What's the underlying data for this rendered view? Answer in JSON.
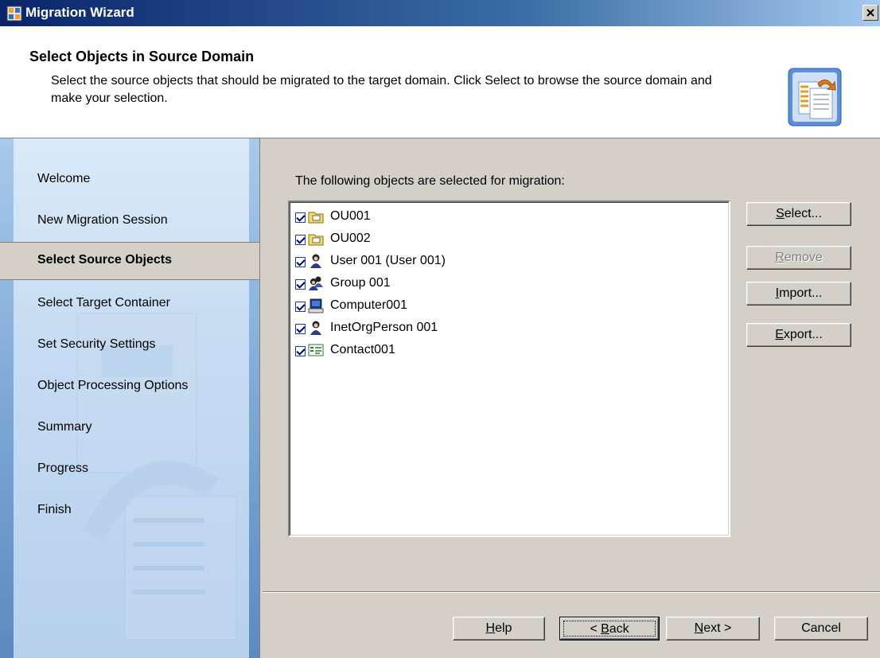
{
  "window": {
    "title": "Migration Wizard"
  },
  "header": {
    "title": "Select Objects in Source Domain",
    "description": "Select the source objects that should be migrated to the target domain. Click Select to browse the source domain and make your selection."
  },
  "nav": {
    "items": [
      "Welcome",
      "New Migration Session",
      "Select Source Objects",
      "Select Target Container",
      "Set Security Settings",
      "Object Processing Options",
      "Summary",
      "Progress",
      "Finish"
    ],
    "current_index": 2
  },
  "main": {
    "list_label": "The following objects are selected for migration:",
    "objects": [
      {
        "label": "OU001",
        "icon": "ou-folder-icon",
        "checked": true
      },
      {
        "label": "OU002",
        "icon": "ou-folder-icon",
        "checked": true
      },
      {
        "label": "User 001 (User 001)",
        "icon": "user-icon",
        "checked": true
      },
      {
        "label": "Group 001",
        "icon": "group-icon",
        "checked": true
      },
      {
        "label": "Computer001",
        "icon": "computer-icon",
        "checked": true
      },
      {
        "label": "InetOrgPerson 001",
        "icon": "user-icon",
        "checked": true
      },
      {
        "label": "Contact001",
        "icon": "contact-icon",
        "checked": true
      }
    ]
  },
  "side_buttons": {
    "select": {
      "pre": "",
      "key": "S",
      "post": "elect..."
    },
    "remove": {
      "pre": "",
      "key": "R",
      "post": "emove"
    },
    "import": {
      "pre": "",
      "key": "I",
      "post": "mport..."
    },
    "export": {
      "pre": "",
      "key": "E",
      "post": "xport..."
    }
  },
  "footer_buttons": {
    "help": {
      "pre": "",
      "key": "H",
      "post": "elp"
    },
    "back": {
      "pre": "< ",
      "key": "B",
      "post": "ack"
    },
    "next": {
      "pre": "",
      "key": "N",
      "post": "ext >"
    },
    "cancel": "Cancel"
  }
}
